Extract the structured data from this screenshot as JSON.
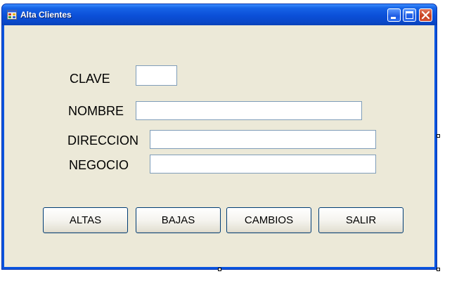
{
  "window": {
    "title": "Alta Clientes",
    "buttons": {
      "minimize": "minimize-icon",
      "maximize": "maximize-icon",
      "close": "close-icon"
    }
  },
  "form": {
    "clave": {
      "label": "CLAVE",
      "value": ""
    },
    "nombre": {
      "label": "NOMBRE",
      "value": ""
    },
    "direccion": {
      "label": "DIRECCION",
      "value": ""
    },
    "negocio": {
      "label": "NEGOCIO",
      "value": ""
    }
  },
  "actions": {
    "altas": "ALTAS",
    "bajas": "BAJAS",
    "cambios": "CAMBIOS",
    "salir": "SALIR"
  },
  "colors": {
    "titlebar": "#0a55e0",
    "client_background": "#ece9d8",
    "close_button": "#c6401f"
  }
}
